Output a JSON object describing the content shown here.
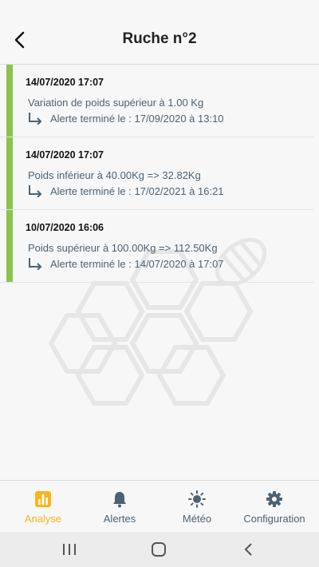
{
  "header": {
    "title": "Ruche n°2"
  },
  "alerts": [
    {
      "date": "14/07/2020 17:07",
      "description": "Variation de poids supérieur à 1.00 Kg",
      "end": "Alerte terminé le : 17/09/2020 à 13:10",
      "status_color": "#8bc34a"
    },
    {
      "date": "14/07/2020 17:07",
      "description": "Poids inférieur à 40.00Kg => 32.82Kg",
      "end": "Alerte terminé le : 17/02/2021 à 16:21",
      "status_color": "#8bc34a"
    },
    {
      "date": "10/07/2020 16:06",
      "description": "Poids supérieur à 100.00Kg => 112.50Kg",
      "end": "Alerte terminé le : 14/07/2020 à 17:07",
      "status_color": "#8bc34a"
    }
  ],
  "tabs": [
    {
      "label": "Analyse",
      "icon": "chart-icon",
      "active": true
    },
    {
      "label": "Alertes",
      "icon": "bell-icon",
      "active": false
    },
    {
      "label": "Météo",
      "icon": "sun-icon",
      "active": false
    },
    {
      "label": "Configuration",
      "icon": "gear-icon",
      "active": false
    }
  ],
  "colors": {
    "accent": "#f6b51e",
    "status_ok": "#8bc34a",
    "text_secondary": "#4d6272"
  },
  "system_nav": [
    {
      "icon": "recent-apps-icon"
    },
    {
      "icon": "home-icon"
    },
    {
      "icon": "back-nav-icon"
    }
  ]
}
